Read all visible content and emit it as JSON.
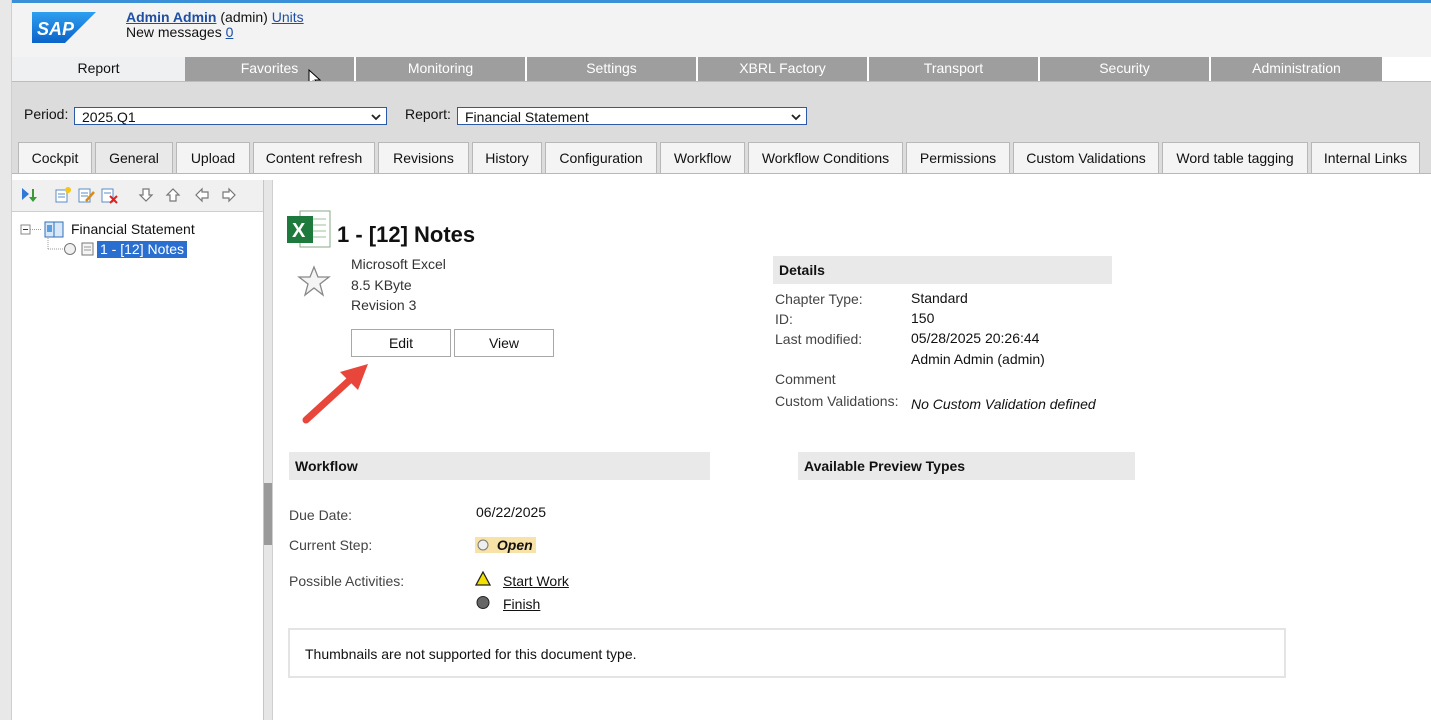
{
  "header": {
    "logo_text": "SAP",
    "user_name": "Admin Admin",
    "user_id": "(admin)",
    "units_link": "Units",
    "messages_label": "New messages",
    "messages_count": "0"
  },
  "main_nav": [
    "Report",
    "Favorites",
    "Monitoring",
    "Settings",
    "XBRL Factory",
    "Transport",
    "Security",
    "Administration"
  ],
  "toolbar": {
    "period_label": "Period:",
    "period_value": "2025.Q1",
    "report_label": "Report:",
    "report_value": "Financial Statement"
  },
  "sub_tabs": [
    "Cockpit",
    "General",
    "Upload",
    "Content refresh",
    "Revisions",
    "History",
    "Configuration",
    "Workflow",
    "Workflow Conditions",
    "Permissions",
    "Custom Validations",
    "Word table tagging",
    "Internal Links"
  ],
  "tree": {
    "root": "Financial Statement",
    "child": "1 - [12] Notes"
  },
  "document": {
    "title": "1 - [12] Notes",
    "app": "Microsoft Excel",
    "size": "8.5 KByte",
    "revision": "Revision 3",
    "edit_label": "Edit",
    "view_label": "View"
  },
  "details": {
    "heading": "Details",
    "chapter_type_label": "Chapter Type:",
    "chapter_type": "Standard",
    "id_label": "ID:",
    "id": "150",
    "last_modified_label": "Last modified:",
    "last_modified": "05/28/2025 20:26:44",
    "modified_by": "Admin Admin (admin)",
    "comment_label": "Comment",
    "custom_validations_label": "Custom Validations:",
    "custom_validations": "No Custom Validation defined"
  },
  "workflow": {
    "heading": "Workflow",
    "due_date_label": "Due Date:",
    "due_date": "06/22/2025",
    "current_step_label": "Current Step:",
    "current_step": "Open",
    "activities_label": "Possible Activities:",
    "activity_start": "Start Work",
    "activity_finish": "Finish"
  },
  "preview": {
    "heading": "Available Preview Types",
    "thumbnail_message": "Thumbnails are not supported for this document type."
  },
  "colors": {
    "accent_blue": "#3b8fd6",
    "tab_gray": "#9e9e9e",
    "selection_blue": "#2a6fd0",
    "arrow_red": "#e8463b",
    "excel_green": "#1e7a3c",
    "open_highlight": "#f7e3a7"
  }
}
